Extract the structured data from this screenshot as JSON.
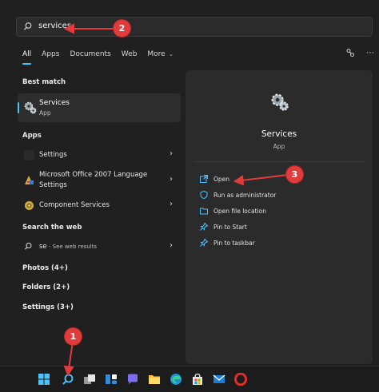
{
  "search": {
    "query": "services"
  },
  "tabs": [
    "All",
    "Apps",
    "Documents",
    "Web",
    "More"
  ],
  "active_tab": "All",
  "sections": {
    "best_match": "Best match",
    "apps": "Apps",
    "search_web": "Search the web"
  },
  "best_match": {
    "title": "Services",
    "subtitle": "App",
    "icon": "services-gear-icon"
  },
  "apps": [
    {
      "label": "Settings",
      "icon": "settings-icon"
    },
    {
      "label": "Microsoft Office 2007 Language",
      "label2": "Settings",
      "icon": "office-language-icon"
    },
    {
      "label": "Component Services",
      "icon": "component-services-icon"
    }
  ],
  "web": {
    "label": "se",
    "sub": " - See web results"
  },
  "groups": [
    {
      "label": "Photos (4+)"
    },
    {
      "label": "Folders (2+)"
    },
    {
      "label": "Settings (3+)"
    }
  ],
  "preview": {
    "title": "Services",
    "subtitle": "App",
    "actions": [
      {
        "label": "Open",
        "icon": "open-icon"
      },
      {
        "label": "Run as administrator",
        "icon": "shield-icon"
      },
      {
        "label": "Open file location",
        "icon": "folder-icon"
      },
      {
        "label": "Pin to Start",
        "icon": "pin-icon"
      },
      {
        "label": "Pin to taskbar",
        "icon": "pin-icon"
      }
    ]
  },
  "callouts": [
    "1",
    "2",
    "3"
  ],
  "colors": {
    "accent": "#4cc2ff",
    "callout": "#e23b3b",
    "background": "#202020"
  }
}
